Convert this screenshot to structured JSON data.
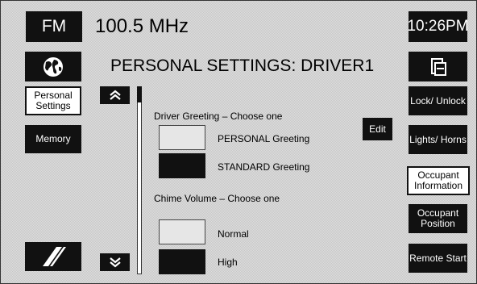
{
  "band": "FM",
  "frequency": "100.5 MHz",
  "clock": "10:26PM",
  "title": "PERSONAL SETTINGS: DRIVER1",
  "left_nav": {
    "personal_settings": "Personal Settings",
    "memory": "Memory"
  },
  "right_nav": {
    "lock_unlock": "Lock/ Unlock",
    "lights_horns": "Lights/ Horns",
    "occupant_information": "Occupant Information",
    "occupant_position": "Occupant Position",
    "remote_start": "Remote Start"
  },
  "driver_greeting": {
    "heading": "Driver Greeting – Choose one",
    "edit_label": "Edit",
    "options": [
      {
        "label": "PERSONAL Greeting",
        "selected": false
      },
      {
        "label": "STANDARD Greeting",
        "selected": true
      }
    ]
  },
  "chime_volume": {
    "heading": "Chime Volume – Choose one",
    "options": [
      {
        "label": "Normal",
        "selected": false
      },
      {
        "label": "High",
        "selected": true
      }
    ]
  },
  "icons": {
    "globe": "globe-icon",
    "screen": "screen-icon",
    "scroll_up": "chevron-up-icon",
    "scroll_down": "chevron-down-icon",
    "stripes": "stripes-icon"
  }
}
